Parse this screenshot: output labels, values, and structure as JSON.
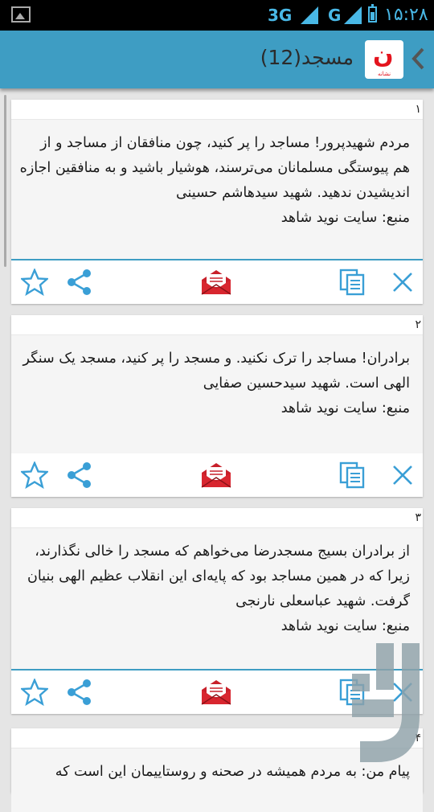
{
  "status_bar": {
    "network_1": "3G",
    "network_2": "G",
    "time": "۱۵:۲۸",
    "battery_level": 0.6
  },
  "action_bar": {
    "title": "مسجد(12)",
    "logo_mark": "ن",
    "logo_caption": "نشانه"
  },
  "cards": [
    {
      "number": "۱",
      "text": "مردم شهیدپرور! مساجد را پر کنید، چون منافقان از مساجد و از هم پیوستگی مسلمانان می‌ترسند، هوشیار باشید و به منافقین اجازه اندیشیدن ندهید. شهید سیدهاشم حسینی",
      "source": "منبع: سایت نوید شاهد"
    },
    {
      "number": "۲",
      "text": "برادران! مساجد را ترک نکنید. و مسجد را پر کنید، مسجد یک سنگر الهی است. شهید سیدحسین صفایی",
      "source": "منبع: سایت نوید شاهد"
    },
    {
      "number": "۳",
      "text": "از برادران بسیج مسجدرضا می‌خواهم که مسجد را خالی نگذارند، زیرا که در همین مساجد بود که پایه‌ای این انقلاب عظیم الهی بنیان گرفت.  شهید عباسعلی نارنجی",
      "source": "منبع: سایت نوید شاهد"
    },
    {
      "number": "۴",
      "text": "پیام من: به مردم همیشه در صحنه و روستاییمان این است که",
      "source": ""
    }
  ],
  "colors": {
    "accent": "#3e9dc3",
    "mail_red": "#c8202a",
    "icon_blue": "#3a9fd6"
  }
}
